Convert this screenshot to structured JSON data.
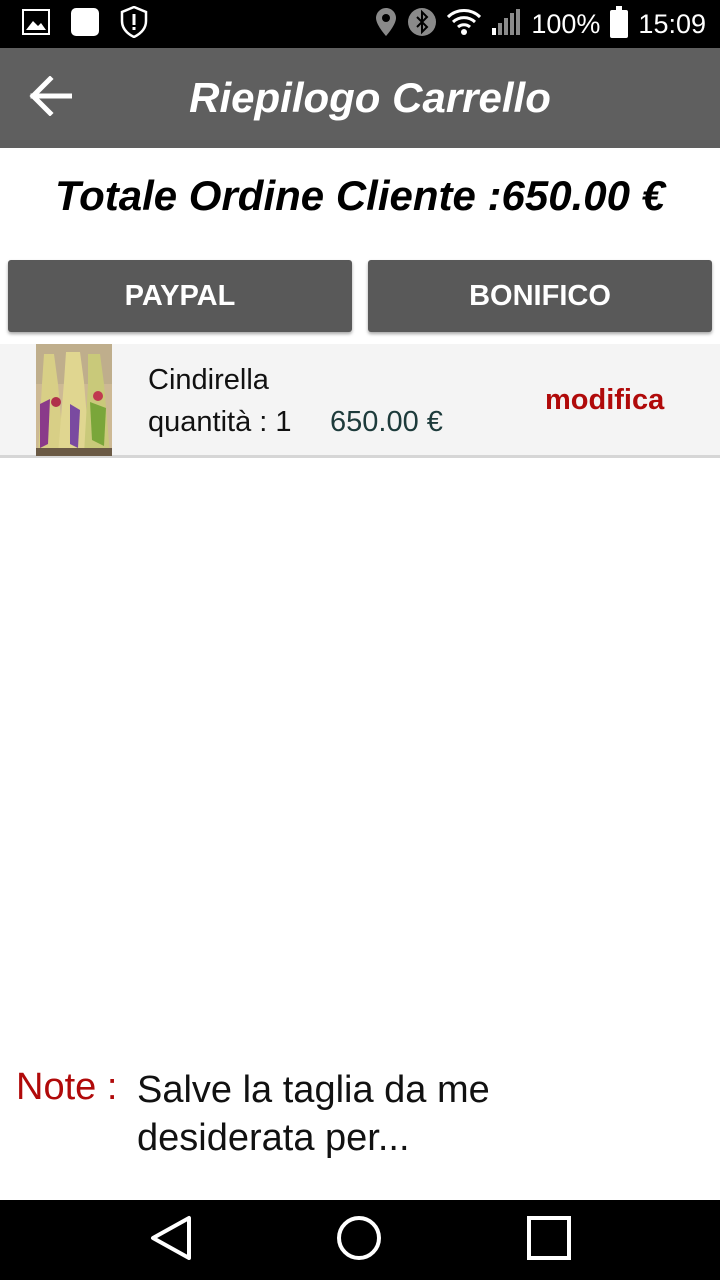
{
  "status_bar": {
    "battery": "100%",
    "time": "15:09",
    "icons": [
      "image-icon",
      "square-app-icon",
      "shield-alert-icon",
      "location-icon",
      "bluetooth-icon",
      "wifi-icon",
      "signal-icon",
      "battery-icon"
    ]
  },
  "header": {
    "title": "Riepilogo Carrello",
    "back_icon": "arrow-left-icon",
    "background": "#5f5f5f"
  },
  "order": {
    "total_label": "Totale Ordine Cliente :650.00 €"
  },
  "payment": {
    "paypal_label": "PAYPAL",
    "bonifico_label": "BONIFICO",
    "button_color": "#595959"
  },
  "cart": {
    "items": [
      {
        "name": "Cindirella",
        "quantity_label": "quantità : 1",
        "price": "650.00 €",
        "edit_label": "modifica"
      }
    ]
  },
  "notes": {
    "label": "Note :",
    "text": "Salve la taglia da me desiderata per..."
  },
  "colors": {
    "accent_red": "#b00a0a",
    "price_color": "#1d3b3b"
  },
  "nav_bar": {
    "icons": [
      "back-triangle-icon",
      "home-circle-icon",
      "recents-square-icon"
    ]
  }
}
